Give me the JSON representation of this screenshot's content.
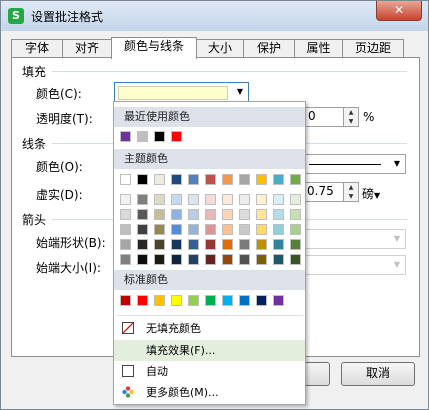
{
  "window": {
    "title": "设置批注格式",
    "app_icon": "S",
    "close_label": "✕"
  },
  "tabs": [
    {
      "label": "字体"
    },
    {
      "label": "对齐"
    },
    {
      "label": "颜色与线条",
      "active": true
    },
    {
      "label": "大小"
    },
    {
      "label": "保护"
    },
    {
      "label": "属性"
    },
    {
      "label": "页边距"
    }
  ],
  "fill": {
    "section": "填充",
    "color_label": "颜色(C):",
    "color_value": "#ffffcc",
    "transparency_label": "透明度(T):",
    "transparency_value": "0",
    "transparency_unit": "%"
  },
  "line": {
    "section": "线条",
    "color_label": "颜色(O):",
    "dash_label": "虚实(D):",
    "weight_value": "0.75",
    "weight_unit": "磅"
  },
  "arrow": {
    "section": "箭头",
    "begin_style_label": "始端形状(B):",
    "begin_size_label": "始端大小(I):"
  },
  "buttons": {
    "cancel": "取消"
  },
  "color_popup": {
    "recent_title": "最近使用颜色",
    "recent": [
      "#7030a0",
      "#bfbfbf",
      "#000000",
      "#ff0000"
    ],
    "theme_title": "主题颜色",
    "theme_top": [
      "#ffffff",
      "#000000",
      "#eeece1",
      "#1f497d",
      "#4f81bd",
      "#c0504d",
      "#f79646",
      "#a5a5a5",
      "#ffc000",
      "#4bacc6",
      "#70ad47"
    ],
    "theme_shades": [
      [
        "#f2f2f2",
        "#d9d9d9",
        "#bfbfbf",
        "#a6a6a6",
        "#7f7f7f"
      ],
      [
        "#7f7f7f",
        "#595959",
        "#404040",
        "#262626",
        "#0d0d0d"
      ],
      [
        "#ddd9c3",
        "#c4bd97",
        "#938953",
        "#494429",
        "#1d1b10"
      ],
      [
        "#c6d9f0",
        "#8db3e2",
        "#548dd4",
        "#17365d",
        "#0f243e"
      ],
      [
        "#dbe5f1",
        "#b8cce4",
        "#95b3d7",
        "#366092",
        "#244061"
      ],
      [
        "#f2dcdb",
        "#e5b9b7",
        "#d99694",
        "#953734",
        "#632423"
      ],
      [
        "#fdeada",
        "#fbd5b5",
        "#fac08f",
        "#e36c09",
        "#974806"
      ],
      [
        "#ededed",
        "#dbdbdb",
        "#c9c9c9",
        "#7b7b7b",
        "#525252"
      ],
      [
        "#fff2cc",
        "#ffe599",
        "#ffd966",
        "#bf9000",
        "#7f6000"
      ],
      [
        "#dbeef3",
        "#b7dde8",
        "#92cddc",
        "#31859b",
        "#205867"
      ],
      [
        "#e2efd9",
        "#c5e0b3",
        "#a8d08d",
        "#538135",
        "#375623"
      ]
    ],
    "standard_title": "标准颜色",
    "standard": [
      "#c00000",
      "#ff0000",
      "#ffc000",
      "#ffff00",
      "#92d050",
      "#00b050",
      "#00b0f0",
      "#0070c0",
      "#002060",
      "#7030a0"
    ],
    "no_fill": "无填充颜色",
    "fill_effects": "填充效果(F)...",
    "automatic": "自动",
    "more_colors": "更多颜色(M)..."
  }
}
